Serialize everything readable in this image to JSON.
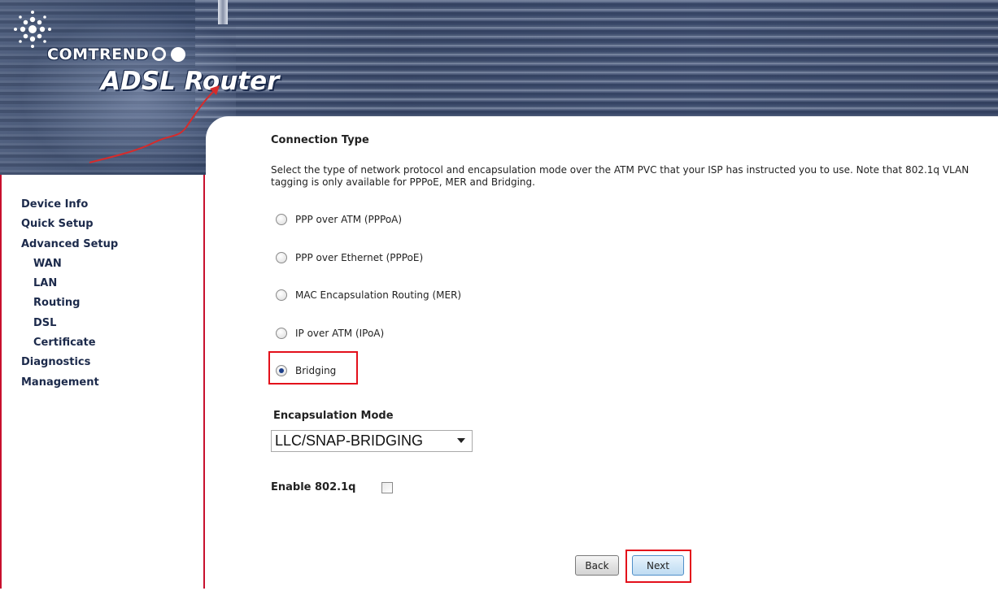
{
  "app": {
    "brand": "COMTREND",
    "product": "ADSL Router"
  },
  "sidebar": {
    "items": [
      {
        "label": "Device Info",
        "level": 0
      },
      {
        "label": "Quick Setup",
        "level": 0
      },
      {
        "label": "Advanced Setup",
        "level": 0
      },
      {
        "label": "WAN",
        "level": 1
      },
      {
        "label": "LAN",
        "level": 1
      },
      {
        "label": "Routing",
        "level": 1
      },
      {
        "label": "DSL",
        "level": 1
      },
      {
        "label": "Certificate",
        "level": 1
      },
      {
        "label": "Diagnostics",
        "level": 0
      },
      {
        "label": "Management",
        "level": 0
      }
    ]
  },
  "main": {
    "title": "Connection Type",
    "description": "Select the type of network protocol and encapsulation mode over the ATM PVC that your ISP has instructed you to use. Note that 802.1q VLAN tagging is only available for PPPoE, MER and Bridging.",
    "connection_types": [
      {
        "label": "PPP over ATM (PPPoA)",
        "checked": false
      },
      {
        "label": "PPP over Ethernet (PPPoE)",
        "checked": false
      },
      {
        "label": "MAC Encapsulation Routing (MER)",
        "checked": false
      },
      {
        "label": "IP over ATM (IPoA)",
        "checked": false
      },
      {
        "label": "Bridging",
        "checked": true
      }
    ],
    "encapsulation": {
      "label": "Encapsulation Mode",
      "value": "LLC/SNAP-BRIDGING"
    },
    "vlan": {
      "label": "Enable 802.1q",
      "checked": false
    },
    "buttons": {
      "back": "Back",
      "next": "Next"
    }
  },
  "colors": {
    "highlight": "#e3101b",
    "sidebar_border": "#c8102e",
    "nav_text": "#1c2a4b",
    "banner": "#2f3e5c"
  }
}
